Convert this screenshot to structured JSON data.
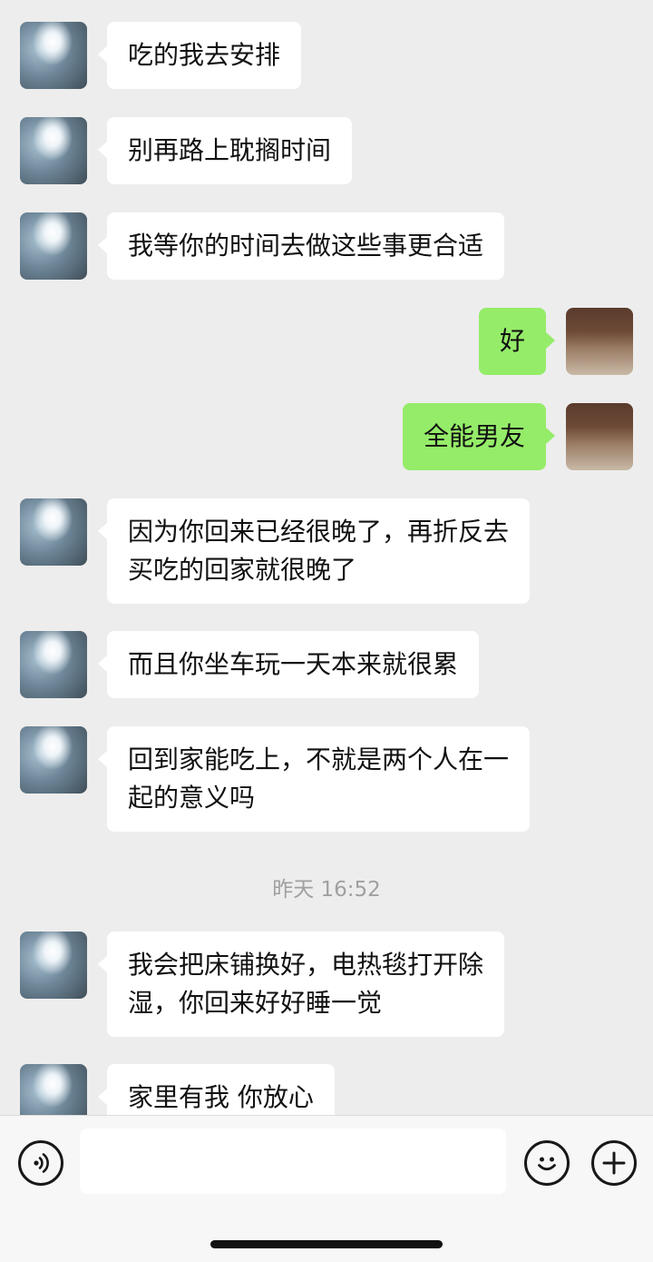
{
  "conversation": {
    "messages": [
      {
        "side": "left",
        "text": "吃的我去安排"
      },
      {
        "side": "left",
        "text": "别再路上耽搁时间"
      },
      {
        "side": "left",
        "text": "我等你的时间去做这些事更合适"
      },
      {
        "side": "right",
        "text": "好"
      },
      {
        "side": "right",
        "text": "全能男友"
      },
      {
        "side": "left",
        "text": "因为你回来已经很晚了，再折反去\n买吃的回家就很晚了"
      },
      {
        "side": "left",
        "text": "而且你坐车玩一天本来就很累"
      },
      {
        "side": "left",
        "text": "回到家能吃上，不就是两个人在一\n起的意义吗"
      },
      {
        "side": "left",
        "text": "我会把床铺换好，电热毯打开除\n湿，你回来好好睡一觉"
      },
      {
        "side": "left",
        "text": "家里有我 你放心"
      }
    ],
    "timestamp": "昨天 16:52"
  },
  "input_bar": {
    "text_value": "",
    "voice_icon": "voice-icon",
    "emoji_icon": "emoji-icon",
    "plus_icon": "plus-icon"
  },
  "colors": {
    "background": "#ededed",
    "incoming_bubble": "#ffffff",
    "outgoing_bubble": "#95ec69",
    "timestamp_text": "#a0a0a0"
  }
}
